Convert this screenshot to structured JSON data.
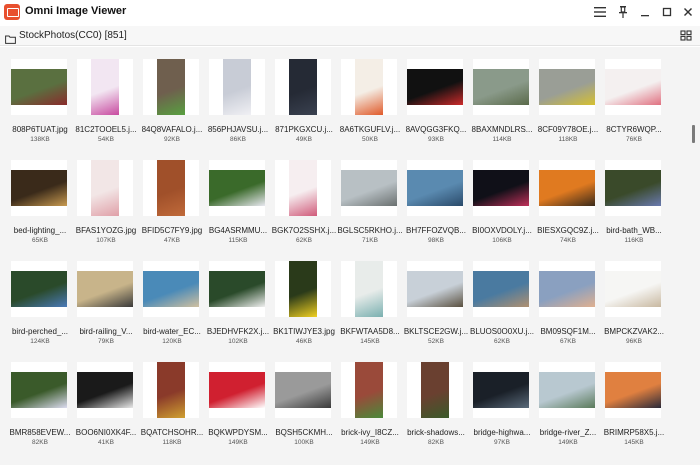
{
  "window": {
    "title": "Omni Image Viewer",
    "controls": [
      {
        "name": "menu-icon"
      },
      {
        "name": "pin-icon"
      },
      {
        "name": "minimize-icon"
      },
      {
        "name": "maximize-icon"
      },
      {
        "name": "close-icon"
      }
    ]
  },
  "path": {
    "label": "StockPhotos(CC0) [851]",
    "icon": "folder-icon",
    "view_toggle_icon": "grid-view-icon"
  },
  "thumbnails": [
    {
      "name": "808P6TUAT.jpg",
      "size": "138KB",
      "colors": [
        "#ffffff",
        "#5a7040",
        "#8a2b2b"
      ]
    },
    {
      "name": "81C2TOOEL5.j...",
      "size": "54KB",
      "colors": [
        "#ffffff",
        "#f2e6f2",
        "#c84aa0"
      ]
    },
    {
      "name": "84Q8VAFALO.j...",
      "size": "92KB",
      "colors": [
        "#ffffff",
        "#6f5f4e",
        "#58a040"
      ]
    },
    {
      "name": "856PHJAVSU.j...",
      "size": "86KB",
      "colors": [
        "#ffffff",
        "#c8ccd6",
        "#f0f0f4"
      ]
    },
    {
      "name": "871PKGXCU.j...",
      "size": "49KB",
      "colors": [
        "#ffffff",
        "#252a35",
        "#3a4150"
      ]
    },
    {
      "name": "8A6TKGUFLV.j...",
      "size": "50KB",
      "colors": [
        "#ffffff",
        "#f4eee6",
        "#e05a2a"
      ]
    },
    {
      "name": "8AVQGG3FKQ...",
      "size": "93KB",
      "colors": [
        "#ffffff",
        "#111111",
        "#cc2a2a"
      ]
    },
    {
      "name": "8BAXMNDLRS...",
      "size": "114KB",
      "colors": [
        "#ffffff",
        "#8a9a8a",
        "#5a6a4a"
      ]
    },
    {
      "name": "8CF09Y78OE.j...",
      "size": "118KB",
      "colors": [
        "#ffffff",
        "#9a9e96",
        "#d6c030"
      ]
    },
    {
      "name": "8CTYR6WQP...",
      "size": "76KB",
      "colors": [
        "#ffffff",
        "#f4f0f0",
        "#e07080"
      ]
    },
    {
      "name": "bed-lighting_...",
      "size": "65KB",
      "colors": [
        "#ffffff",
        "#3a2a1a",
        "#c89a50"
      ]
    },
    {
      "name": "BFAS1YOZG.jpg",
      "size": "107KB",
      "colors": [
        "#ffffff",
        "#f2e6e6",
        "#e0a0a8"
      ]
    },
    {
      "name": "BFID5C7FY9.jpg",
      "size": "47KB",
      "colors": [
        "#ffffff",
        "#a0502a",
        "#c06a3a"
      ]
    },
    {
      "name": "BG4ASRMMU...",
      "size": "115KB",
      "colors": [
        "#ffffff",
        "#3a6a2a",
        "#e8e8f0"
      ]
    },
    {
      "name": "BGK7O2SSHX.j...",
      "size": "62KB",
      "colors": [
        "#ffffff",
        "#f6eef0",
        "#d05a7a"
      ]
    },
    {
      "name": "BGLSC5RKHO.j...",
      "size": "71KB",
      "colors": [
        "#ffffff",
        "#b8c0c4",
        "#6a7070"
      ]
    },
    {
      "name": "BH7FFOZVQB...",
      "size": "98KB",
      "colors": [
        "#ffffff",
        "#5a8ab0",
        "#2a4a6a"
      ]
    },
    {
      "name": "BI0OXVDOLY.j...",
      "size": "106KB",
      "colors": [
        "#ffffff",
        "#101018",
        "#c0305a"
      ]
    },
    {
      "name": "BIESXGQC9Z.j...",
      "size": "74KB",
      "colors": [
        "#ffffff",
        "#e07a20",
        "#3a2a1a"
      ]
    },
    {
      "name": "bird-bath_WB...",
      "size": "116KB",
      "colors": [
        "#ffffff",
        "#3a4a2a",
        "#6a7ab0"
      ]
    },
    {
      "name": "bird-perched_...",
      "size": "124KB",
      "colors": [
        "#ffffff",
        "#2a4a2a",
        "#4a7ab8"
      ]
    },
    {
      "name": "bird-railing_V...",
      "size": "79KB",
      "colors": [
        "#ffffff",
        "#c8b48a",
        "#3a3a3a"
      ]
    },
    {
      "name": "bird-water_EC...",
      "size": "120KB",
      "colors": [
        "#ffffff",
        "#4a8ab8",
        "#d0c0a0"
      ]
    },
    {
      "name": "BJEDHVFK2X.j...",
      "size": "102KB",
      "colors": [
        "#ffffff",
        "#2a4a2a",
        "#f0f0f0"
      ]
    },
    {
      "name": "BK1TIWJYE3.jpg",
      "size": "46KB",
      "colors": [
        "#ffffff",
        "#2a3a1a",
        "#f0d020"
      ]
    },
    {
      "name": "BKFWTAA5D8...",
      "size": "145KB",
      "colors": [
        "#ffffff",
        "#e8ecea",
        "#7ab0b0"
      ]
    },
    {
      "name": "BKLTSCE2GW.j...",
      "size": "52KB",
      "colors": [
        "#ffffff",
        "#c8d0d8",
        "#5a5040"
      ]
    },
    {
      "name": "BLUOS0O0XU.j...",
      "size": "62KB",
      "colors": [
        "#ffffff",
        "#4a7aa0",
        "#b09070"
      ]
    },
    {
      "name": "BM09SQF1M...",
      "size": "67KB",
      "colors": [
        "#ffffff",
        "#8aa0c0",
        "#e0b090"
      ]
    },
    {
      "name": "BMPCKZVAK2...",
      "size": "96KB",
      "colors": [
        "#ffffff",
        "#f6f6f4",
        "#c8b8a0"
      ]
    },
    {
      "name": "BMR858EVEW...",
      "size": "82KB",
      "colors": [
        "#ffffff",
        "#3a5a2a",
        "#dcdcf0"
      ]
    },
    {
      "name": "BOO6NI0XK4F...",
      "size": "41KB",
      "colors": [
        "#ffffff",
        "#1a1a1a",
        "#e8e8e8"
      ]
    },
    {
      "name": "BQATCHSOHR...",
      "size": "118KB",
      "colors": [
        "#ffffff",
        "#8a3a2a",
        "#d0a030"
      ]
    },
    {
      "name": "BQKWPDYSM...",
      "size": "149KB",
      "colors": [
        "#ffffff",
        "#d02030",
        "#ffffff"
      ]
    },
    {
      "name": "BQSH5CKMH...",
      "size": "100KB",
      "colors": [
        "#ffffff",
        "#9a9a9a",
        "#3a3a3a"
      ]
    },
    {
      "name": "brick-ivy_I8CZ...",
      "size": "149KB",
      "colors": [
        "#ffffff",
        "#9a4a3a",
        "#4a8a3a"
      ]
    },
    {
      "name": "brick-shadows...",
      "size": "82KB",
      "colors": [
        "#ffffff",
        "#6a4030",
        "#3a5a2a"
      ]
    },
    {
      "name": "bridge-highwa...",
      "size": "97KB",
      "colors": [
        "#ffffff",
        "#1a2028",
        "#5a6a7a"
      ]
    },
    {
      "name": "bridge-river_Z...",
      "size": "149KB",
      "colors": [
        "#ffffff",
        "#b8c8d0",
        "#5a7a5a"
      ]
    },
    {
      "name": "BRIMRP58X5.j...",
      "size": "145KB",
      "colors": [
        "#ffffff",
        "#e08040",
        "#2a2a3a"
      ]
    }
  ]
}
